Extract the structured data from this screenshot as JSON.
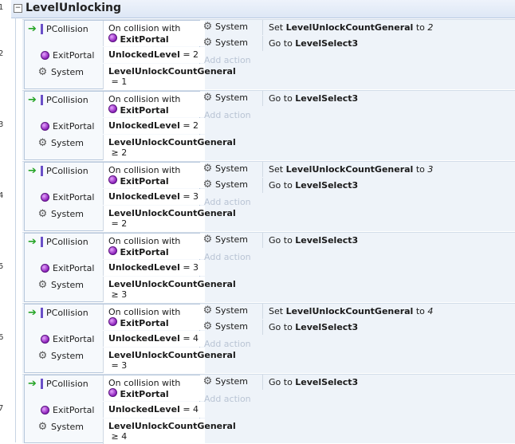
{
  "group": {
    "title": "LevelUnlocking",
    "line_number": "1"
  },
  "add_action_label": "Add action",
  "events": [
    {
      "line_number": "2",
      "conditions": [
        {
          "object": "PCollision",
          "text": "On collision with",
          "target": "ExitPortal"
        },
        {
          "object": "ExitPortal",
          "var": "UnlockedLevel",
          "op": "= 2"
        },
        {
          "object": "System",
          "var": "LevelUnlockCountGeneral",
          "op": "= 1"
        }
      ],
      "actions": [
        {
          "object": "System",
          "prefix": "Set",
          "target": "LevelUnlockCountGeneral",
          "mid": "to",
          "value": "2"
        },
        {
          "object": "System",
          "prefix": "Go to",
          "target": "LevelSelect3",
          "mid": "",
          "value": ""
        }
      ]
    },
    {
      "line_number": "3",
      "conditions": [
        {
          "object": "PCollision",
          "text": "On collision with",
          "target": "ExitPortal"
        },
        {
          "object": "ExitPortal",
          "var": "UnlockedLevel",
          "op": "= 2"
        },
        {
          "object": "System",
          "var": "LevelUnlockCountGeneral",
          "op": "≥ 2"
        }
      ],
      "actions": [
        {
          "object": "System",
          "prefix": "Go to",
          "target": "LevelSelect3",
          "mid": "",
          "value": ""
        }
      ]
    },
    {
      "line_number": "4",
      "conditions": [
        {
          "object": "PCollision",
          "text": "On collision with",
          "target": "ExitPortal"
        },
        {
          "object": "ExitPortal",
          "var": "UnlockedLevel",
          "op": "= 3"
        },
        {
          "object": "System",
          "var": "LevelUnlockCountGeneral",
          "op": "= 2"
        }
      ],
      "actions": [
        {
          "object": "System",
          "prefix": "Set",
          "target": "LevelUnlockCountGeneral",
          "mid": "to",
          "value": "3"
        },
        {
          "object": "System",
          "prefix": "Go to",
          "target": "LevelSelect3",
          "mid": "",
          "value": ""
        }
      ]
    },
    {
      "line_number": "5",
      "conditions": [
        {
          "object": "PCollision",
          "text": "On collision with",
          "target": "ExitPortal"
        },
        {
          "object": "ExitPortal",
          "var": "UnlockedLevel",
          "op": "= 3"
        },
        {
          "object": "System",
          "var": "LevelUnlockCountGeneral",
          "op": "≥ 3"
        }
      ],
      "actions": [
        {
          "object": "System",
          "prefix": "Go to",
          "target": "LevelSelect3",
          "mid": "",
          "value": ""
        }
      ]
    },
    {
      "line_number": "6",
      "conditions": [
        {
          "object": "PCollision",
          "text": "On collision with",
          "target": "ExitPortal"
        },
        {
          "object": "ExitPortal",
          "var": "UnlockedLevel",
          "op": "= 4"
        },
        {
          "object": "System",
          "var": "LevelUnlockCountGeneral",
          "op": "= 3"
        }
      ],
      "actions": [
        {
          "object": "System",
          "prefix": "Set",
          "target": "LevelUnlockCountGeneral",
          "mid": "to",
          "value": "4"
        },
        {
          "object": "System",
          "prefix": "Go to",
          "target": "LevelSelect3",
          "mid": "",
          "value": ""
        }
      ]
    },
    {
      "line_number": "7",
      "conditions": [
        {
          "object": "PCollision",
          "text": "On collision with",
          "target": "ExitPortal"
        },
        {
          "object": "ExitPortal",
          "var": "UnlockedLevel",
          "op": "= 4"
        },
        {
          "object": "System",
          "var": "LevelUnlockCountGeneral",
          "op": "≥ 4"
        }
      ],
      "actions": [
        {
          "object": "System",
          "prefix": "Go to",
          "target": "LevelSelect3",
          "mid": "",
          "value": ""
        }
      ]
    }
  ]
}
